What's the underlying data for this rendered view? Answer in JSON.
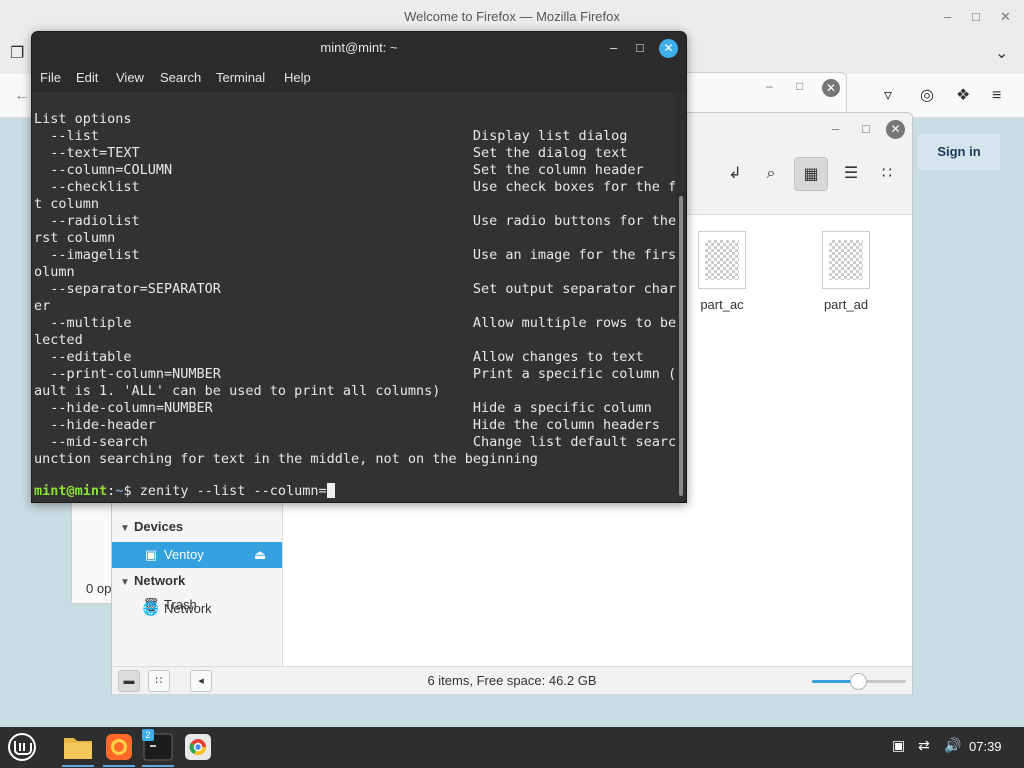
{
  "firefox": {
    "title": "Welcome to Firefox — Mozilla Firefox",
    "signin_label": "Sign in"
  },
  "back_dialog": {
    "status_text": "0 op"
  },
  "nemo": {
    "sidebar": {
      "partial_item": "Trash",
      "devices_header": "Devices",
      "device_item": "Ventoy",
      "network_header": "Network",
      "network_item": "Network"
    },
    "files": [
      {
        "name": "part_ac"
      },
      {
        "name": "part_ad"
      }
    ],
    "status_text": "6 items, Free space: 46.2 GB",
    "zoom_level": 0.5
  },
  "terminal": {
    "title": "mint@mint: ~",
    "menu": [
      "File",
      "Edit",
      "View",
      "Search",
      "Terminal",
      "Help"
    ],
    "output_lines": [
      "List options",
      "  --list                                              Display list dialog",
      "  --text=TEXT                                         Set the dialog text",
      "  --column=COLUMN                                     Set the column header",
      "  --checklist                                         Use check boxes for the firs",
      "t column",
      "  --radiolist                                         Use radio buttons for the fi",
      "rst column",
      "  --imagelist                                         Use an image for the first c",
      "olumn",
      "  --separator=SEPARATOR                               Set output separator charact",
      "er",
      "  --multiple                                          Allow multiple rows to be se",
      "lected",
      "  --editable                                          Allow changes to text",
      "  --print-column=NUMBER                               Print a specific column (Def",
      "ault is 1. 'ALL' can be used to print all columns)",
      "  --hide-column=NUMBER                                Hide a specific column",
      "  --hide-header                                       Hide the column headers",
      "  --mid-search                                        Change list default search f",
      "unction searching for text in the middle, not on the beginning"
    ],
    "prompt_user": "mint@mint",
    "prompt_sep": ":",
    "prompt_path": "~",
    "prompt_symbol": "$ ",
    "command": "zenity --list --column="
  },
  "taskbar": {
    "terminal_badge": "2",
    "clock": "07:39"
  },
  "colors": {
    "accent": "#35a1df",
    "prompt_user": "#8ae234",
    "prompt_path": "#729fcf",
    "terminal_bg": "#323232"
  }
}
